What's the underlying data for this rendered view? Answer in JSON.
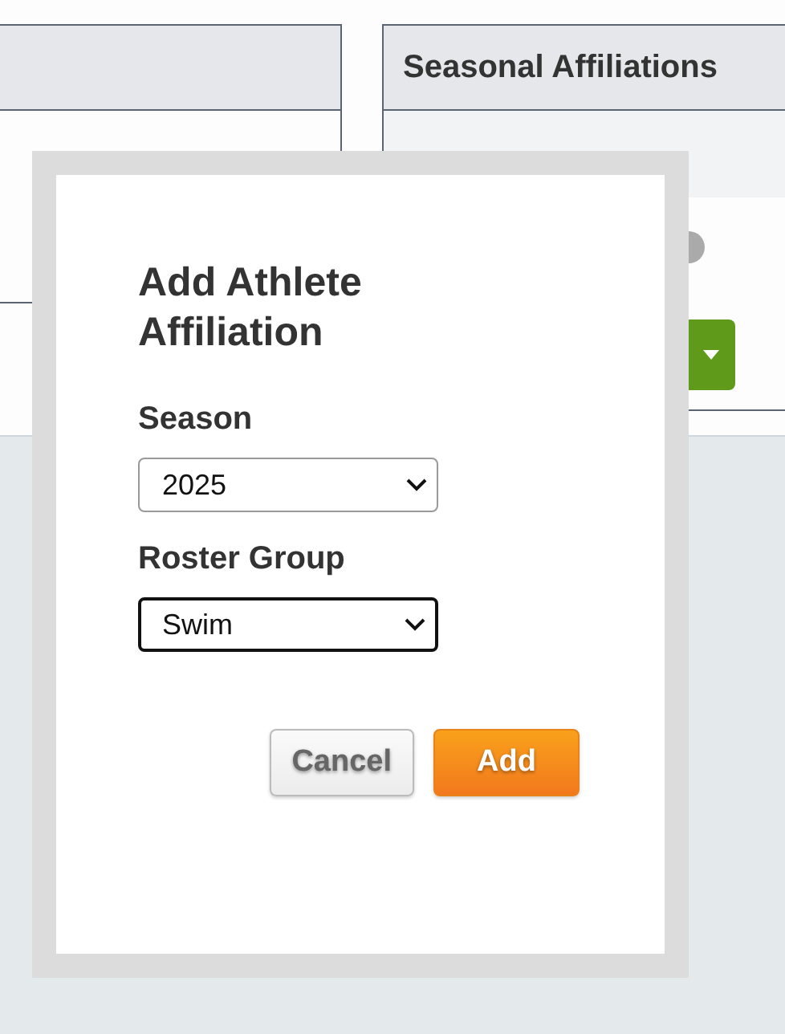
{
  "right_panel": {
    "title": "Seasonal Affiliations"
  },
  "dialog": {
    "title": "Add Athlete Affiliation",
    "fields": [
      {
        "label": "Season",
        "value": "2025",
        "focused": false
      },
      {
        "label": "Roster Group",
        "value": "Swim",
        "focused": true
      }
    ],
    "buttons": [
      {
        "label": "Cancel",
        "kind": "secondary"
      },
      {
        "label": "Add",
        "kind": "primary"
      }
    ]
  }
}
